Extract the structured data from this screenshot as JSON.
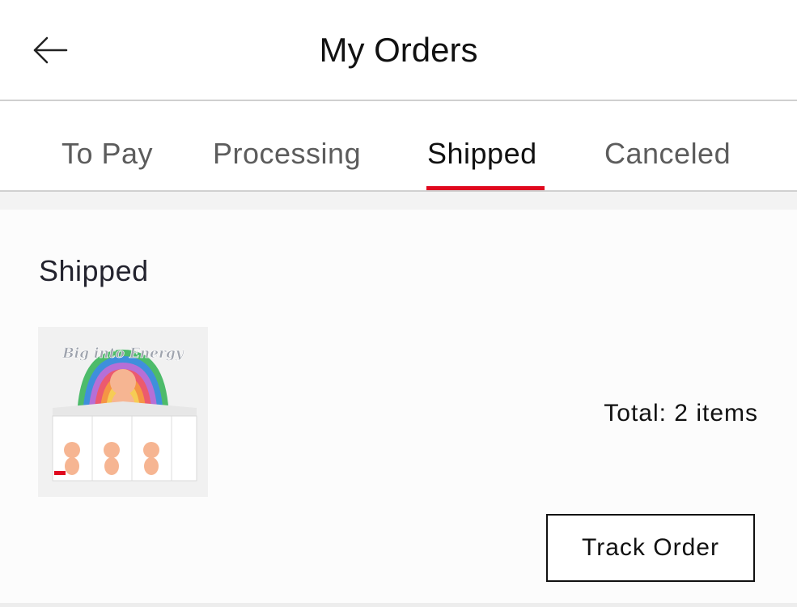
{
  "header": {
    "title": "My Orders",
    "back_icon": "arrow-left-icon"
  },
  "tabs": [
    {
      "label": "To Pay",
      "active": false
    },
    {
      "label": "Processing",
      "active": false
    },
    {
      "label": "Shipped",
      "active": true
    },
    {
      "label": "Canceled",
      "active": false
    }
  ],
  "colors": {
    "accent": "#e0081e",
    "text": "#111111",
    "muted_tab": "#5c5c5c"
  },
  "order": {
    "status": "Shipped",
    "thumbnail_text": "Big into Energy",
    "total": "Total: 2 items",
    "track_label": "Track Order"
  }
}
